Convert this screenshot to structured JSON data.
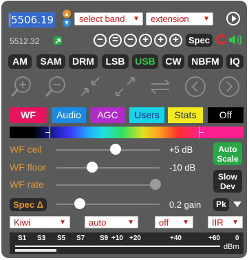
{
  "controls": {
    "frequency": "5506.19",
    "band_select": "select band",
    "ext_select": "extension",
    "freq_readout": "5512.32",
    "spec_label": "Spec"
  },
  "modes": [
    "AM",
    "SAM",
    "DRM",
    "LSB",
    "USB",
    "CW",
    "NBFM",
    "IQ"
  ],
  "active_mode": "USB",
  "tabs": [
    "WF",
    "Audio",
    "AGC",
    "Users",
    "Stats",
    "Off"
  ],
  "waterfall": {
    "ceil_label": "WF ceil",
    "ceil_value": "+5 dB",
    "floor_label": "WF floor",
    "floor_value": "-10 dB",
    "rate_label": "WF rate",
    "auto_scale": "Auto\nScale",
    "slow_dev": "Slow\nDev",
    "spec_delta": "Spec Δ",
    "gain_value": "0.2 gain",
    "pk_label": "Pk"
  },
  "bottom_selects": [
    "Kiwi",
    "auto",
    "off",
    "IIR"
  ],
  "smeter": {
    "labels": [
      "S1",
      "S3",
      "S5",
      "S7",
      "S9",
      "+10",
      "+20",
      "+40",
      "+60"
    ],
    "max_label": "0",
    "unit": "dBm"
  },
  "colors": {
    "panel": "#5a5a5a",
    "active_mode": "#2ecc40",
    "wf": "#e8135f",
    "audio": "#1a8be0",
    "agc": "#b12bc8",
    "users": "#18d3e3",
    "stats": "#f4ea1c",
    "off": "#000000",
    "wf_label": "#e0972b",
    "green_btn": "#2aa845"
  },
  "icons": [
    "zoom-in-icon",
    "zoom-out-icon",
    "zoom-collapse-icon",
    "zoom-expand-icon",
    "swap-arrows-icon",
    "prev-circle-icon",
    "next-circle-icon"
  ]
}
